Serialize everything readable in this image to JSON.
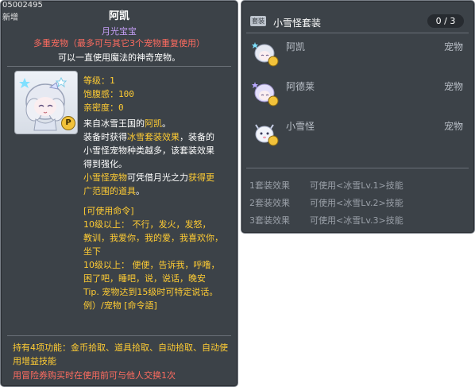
{
  "item": {
    "id": "05002495",
    "new_tag": "新增",
    "name": "阿凯",
    "subtitle": "月光宝宝",
    "multi_pet_note": "多重宠物（最多可与其它3个宠物重复使用）",
    "magic_note": "可以一直使用魔法的神奇宠物。",
    "stats": {
      "level": "等级：1",
      "fullness": "饱腹感：100",
      "closeness": "亲密度：0"
    },
    "desc": {
      "l1a": "来自冰雪王国的",
      "l1b": "阿凯",
      "l1c": "。",
      "l2a": "装备时获得",
      "l2b": "冰雪套装效果",
      "l2c": "，装备的",
      "l3": "小雪怪宠物种类越多，该套装效果",
      "l4": "得到强化。",
      "l5a": "小雪怪宠物",
      "l5b": "可凭借月光之力",
      "l5c": "获得更",
      "l6": "广范围的道具",
      "l6b": "。"
    },
    "commands": [
      "[可使用命令]",
      "10级以上： 不行，发火，发怒，",
      "教训，我爱你，我的爱，我喜欢你，",
      "坐下",
      "10级以上： 便便，告诉我，呼噜，",
      "困了吧，睡吧，说，说话，晚安",
      "Tip. 宠物达到15级时可特定说话。",
      "例）/宠物 [命令語]"
    ],
    "functions": "持有4项功能：金币拾取、道具拾取、自动拾取、自动使用增益技能",
    "trade_note": "用冒险券购买时在使用前可与他人交换1次"
  },
  "set": {
    "badge": "套装",
    "title": "小雪怪套装",
    "count": "0 / 3",
    "items": [
      {
        "name": "阿凯",
        "type": "宠物"
      },
      {
        "name": "阿德莱",
        "type": "宠物"
      },
      {
        "name": "小雪怪",
        "type": "宠物"
      }
    ],
    "effects": [
      {
        "label": "1套装效果",
        "text": "可使用<冰雪Lv.1>技能"
      },
      {
        "label": "2套装效果",
        "text": "可使用<冰雪Lv.2>技能"
      },
      {
        "label": "3套装效果",
        "text": "可使用<冰雪Lv.3>技能"
      }
    ]
  },
  "colors": {
    "panel_bg": "#3c4248",
    "gold": "#ffcc33",
    "purple": "#c39ef5",
    "red": "#ff6c60"
  },
  "icons": {
    "pet_icon": "snow-fairy-pet-icon",
    "coin_badge": "coin-badge-icon",
    "p_badge": "p-badge-icon"
  }
}
